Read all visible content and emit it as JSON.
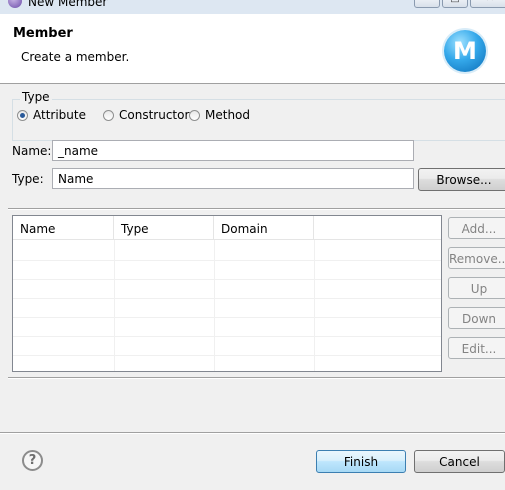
{
  "window": {
    "title": "New Member"
  },
  "header": {
    "title": "Member",
    "description": "Create a member.",
    "logo_letter": "M"
  },
  "type_group": {
    "legend": "Type",
    "options": [
      {
        "label": "Attribute",
        "checked": true
      },
      {
        "label": "Constructor",
        "checked": false
      },
      {
        "label": "Method",
        "checked": false
      }
    ]
  },
  "fields": {
    "name_label": "Name:",
    "name_value": "_name",
    "type_label": "Type:",
    "type_value": "Name",
    "browse_label": "Browse..."
  },
  "table": {
    "columns": [
      "Name",
      "Type",
      "Domain"
    ],
    "rows": []
  },
  "side_buttons": {
    "add": "Add...",
    "remove": "Remove...",
    "up": "Up",
    "down": "Down",
    "edit": "Edit..."
  },
  "footer": {
    "help_icon": "?",
    "finish": "Finish",
    "cancel": "Cancel"
  },
  "icons": {
    "window_icon": "eclipse-icon",
    "logo": "member-m-icon",
    "help": "help-icon"
  },
  "colors": {
    "dialog_bg": "#f0f0f0",
    "header_bg": "#ffffff",
    "logo_blue": "#1e8ad6",
    "default_button_border": "#3c7fb1"
  }
}
